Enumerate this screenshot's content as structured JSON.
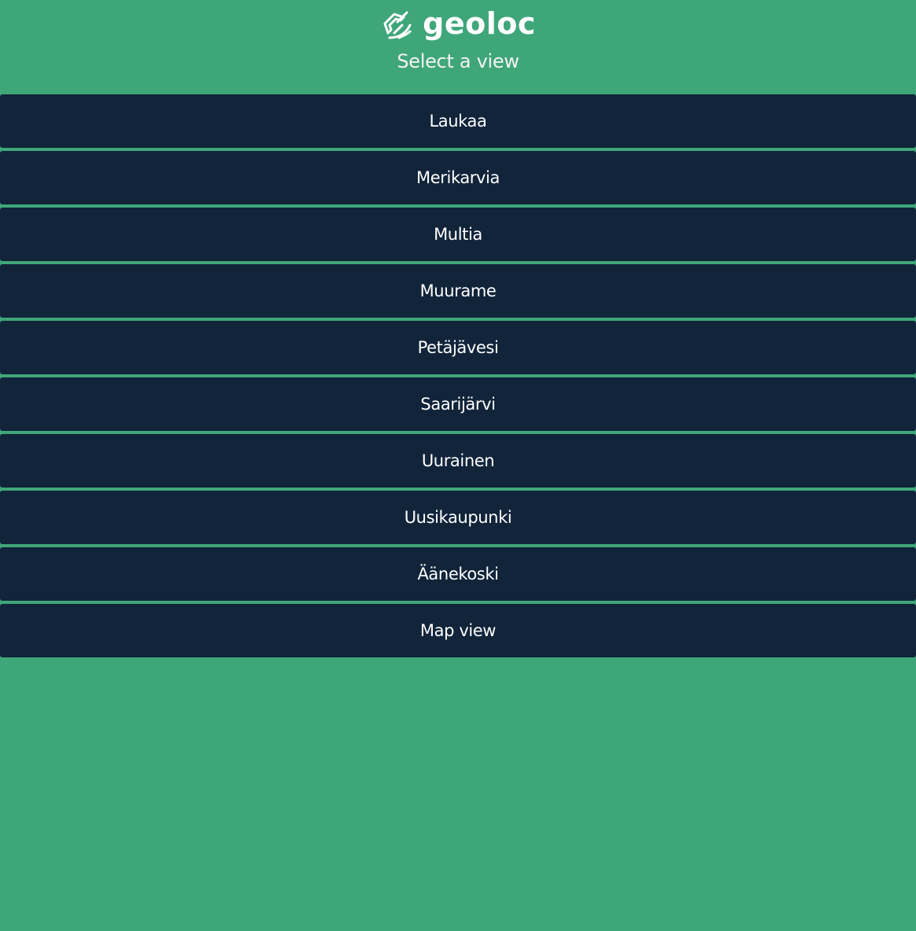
{
  "header": {
    "logo_text": "geoloc",
    "logo_icon": "geoloc-satellite-icon",
    "subtitle": "Select a view"
  },
  "views": [
    {
      "label": "Laukaa"
    },
    {
      "label": "Merikarvia"
    },
    {
      "label": "Multia"
    },
    {
      "label": "Muurame"
    },
    {
      "label": "Petäjävesi"
    },
    {
      "label": "Saarijärvi"
    },
    {
      "label": "Uurainen"
    },
    {
      "label": "Uusikaupunki"
    },
    {
      "label": "Äänekoski"
    },
    {
      "label": "Map view"
    }
  ],
  "colors": {
    "background": "#3fa679",
    "button_background": "#11243a",
    "text": "#ffffff"
  }
}
